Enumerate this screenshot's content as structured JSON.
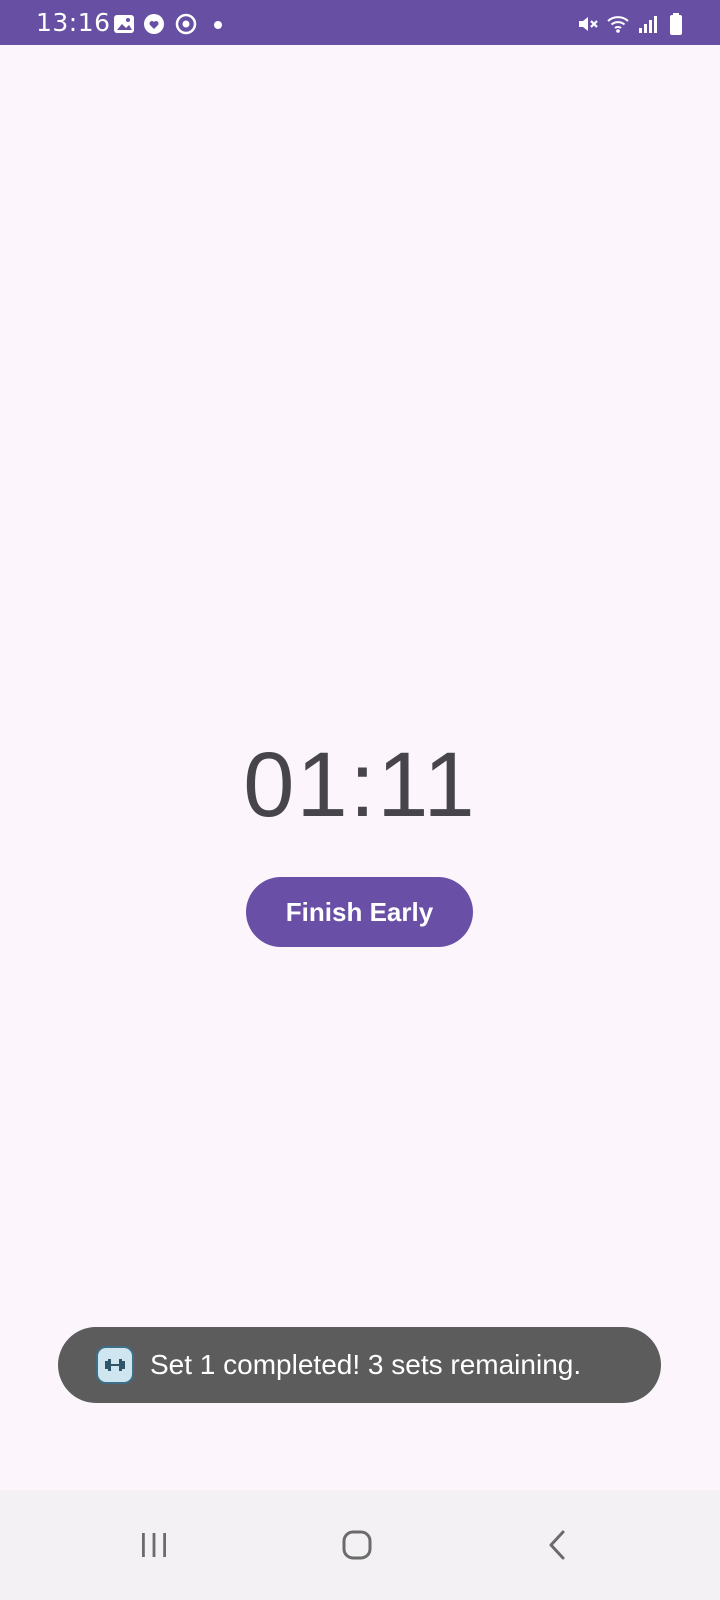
{
  "status_bar": {
    "time": "13:16",
    "color": "#6750A4",
    "left_icons": [
      "gallery-icon",
      "heart-sync-icon",
      "refresh-icon",
      "dot-icon"
    ],
    "right_icons": [
      "mute-icon",
      "wifi-icon",
      "signal-icon",
      "battery-icon"
    ]
  },
  "timer": {
    "display": "01:11"
  },
  "buttons": {
    "finish_label": "Finish Early",
    "finish_color": "#6A4FA6"
  },
  "toast": {
    "icon": "app-dumbbell-icon",
    "message": "Set 1 completed! 3 sets remaining."
  },
  "nav_bar": {
    "items": [
      "recents-icon",
      "home-icon",
      "back-icon"
    ]
  }
}
